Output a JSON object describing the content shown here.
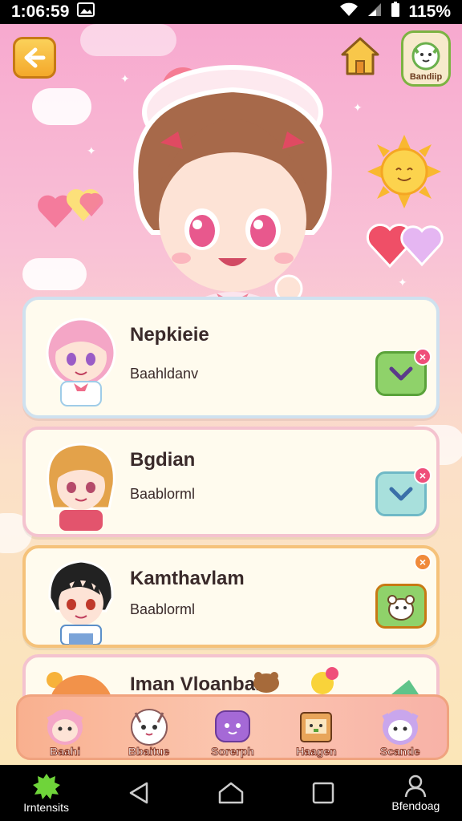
{
  "status": {
    "time": "1:06:59",
    "battery": "115%"
  },
  "header": {
    "badge_label": "Bandiip"
  },
  "cards": [
    {
      "name": "Nepkieie",
      "sub": "Baahldanv",
      "action": "check"
    },
    {
      "name": "Bgdian",
      "sub": "Baablorml",
      "action": "check"
    },
    {
      "name": "Kamthavlam",
      "sub": "Baablorml",
      "action": "pet"
    },
    {
      "name": "Iman Vloanbah",
      "sub": "",
      "action": "arrow"
    }
  ],
  "tabs": [
    {
      "label": "Baahi"
    },
    {
      "label": "Bbaitue"
    },
    {
      "label": "Sorerph"
    },
    {
      "label": "Haagen"
    },
    {
      "label": "Scande"
    }
  ],
  "nav": {
    "left_label": "Irntensits",
    "right_label": "Bfendoag"
  },
  "colors": {
    "accent_pink": "#ef4f7a",
    "check_green": "#8fd26a",
    "check_cyan": "#a8e0dc",
    "tabbar": "#f9b08f"
  }
}
